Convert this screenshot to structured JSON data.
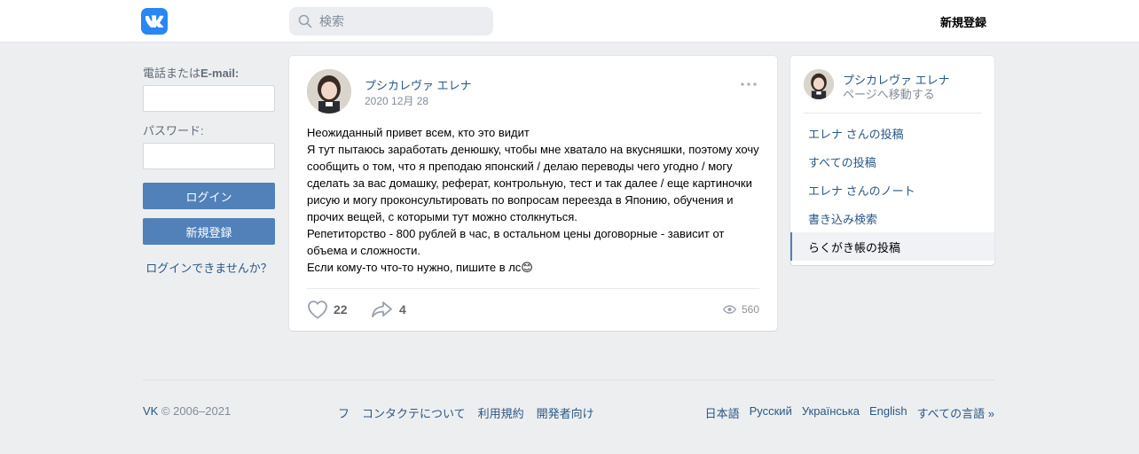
{
  "header": {
    "logo_text": "VK",
    "search_placeholder": "検索",
    "signup_label": "新規登録"
  },
  "login": {
    "phone_label_prefix": "電話または",
    "phone_label_bold": "E-mail:",
    "password_label": "パスワード:",
    "login_button": "ログイン",
    "signup_button": "新規登録",
    "forgot_link": "ログインできませんか？"
  },
  "post": {
    "author": "プシカレヴァ エレナ",
    "date": "2020 12月 28",
    "lines": [
      "Неожиданный привет всем, кто это видит",
      "Я тут пытаюсь заработать денюшку, чтобы мне хватало на вкусняшки, поэтому хочу сообщить о том, что я преподаю японский / делаю переводы чего угодно / могу сделать за вас домашку, реферат, контрольную, тест и так далее / еще картиночки рисую и могу проконсультировать по вопросам переезда в Японию, обучения и прочих вещей, с которыми тут можно столкнуться.",
      "Репетиторство - 800 рублей в час, в остальном цены договорные - зависит от объема и сложности.",
      "Если кому-то что-то нужно, пишите в лс😊"
    ],
    "likes": "22",
    "shares": "4",
    "views": "560"
  },
  "sidebar": {
    "name": "プシカレヴァ エレナ",
    "goto": "ページへ移動する",
    "items": [
      {
        "label": "エレナ さんの投稿"
      },
      {
        "label": "すべての投稿"
      },
      {
        "label": "エレナ さんのノート"
      },
      {
        "label": "書き込み検索"
      },
      {
        "label": "らくがき帳の投稿"
      }
    ]
  },
  "footer": {
    "brand": "VK",
    "copyright": "© 2006–2021",
    "links": [
      "フ",
      "コンタクテについて",
      "利用規約",
      "開発者向け"
    ],
    "languages": [
      "日本語",
      "Русский",
      "Українська",
      "English",
      "すべての言語 »"
    ]
  },
  "colors": {
    "accent": "#5181b8",
    "link": "#2a5885",
    "logo": "#2787f5",
    "background": "#edeef0"
  }
}
